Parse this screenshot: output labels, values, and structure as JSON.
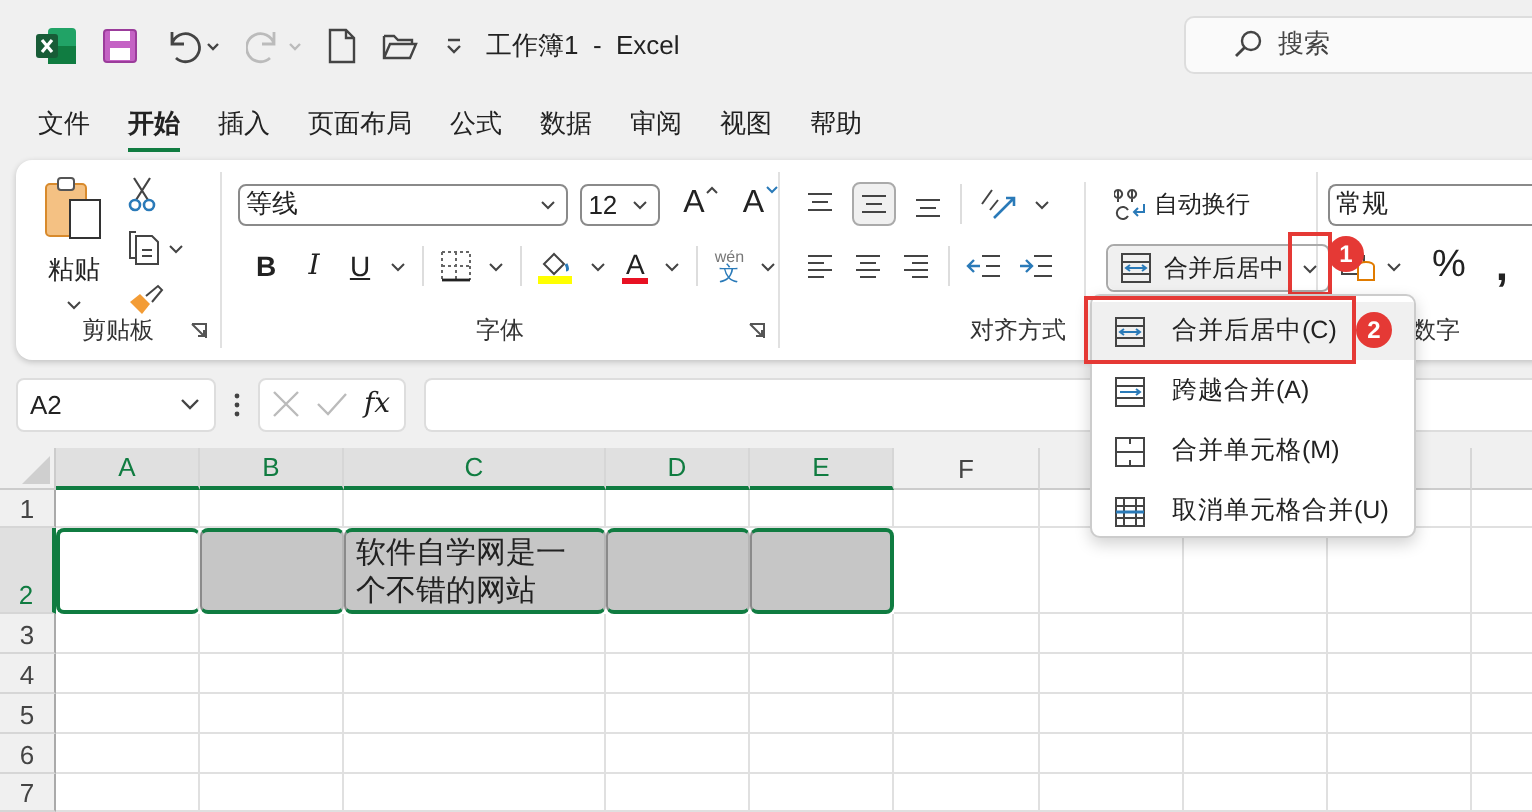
{
  "title_bar": {
    "title": "工作簿1  -  Excel",
    "search": {
      "placeholder": "搜索"
    }
  },
  "tabs": [
    {
      "label": "文件",
      "selected": false
    },
    {
      "label": "开始",
      "selected": true
    },
    {
      "label": "插入",
      "selected": false
    },
    {
      "label": "页面布局",
      "selected": false
    },
    {
      "label": "公式",
      "selected": false
    },
    {
      "label": "数据",
      "selected": false
    },
    {
      "label": "审阅",
      "selected": false
    },
    {
      "label": "视图",
      "selected": false
    },
    {
      "label": "帮助",
      "selected": false
    }
  ],
  "ribbon": {
    "clipboard": {
      "paste": "粘贴",
      "group_label": "剪贴板"
    },
    "font": {
      "font_name": "等线",
      "font_size": "12",
      "grow": "A",
      "shrink": "A",
      "bold": "B",
      "italic": "I",
      "underline": "U",
      "font_color": "A",
      "phonetic_top": "wén",
      "phonetic_bottom": "文",
      "group_label": "字体"
    },
    "alignment": {
      "wrap_text": "自动换行",
      "merge_button": "合并后居中",
      "merge_caret_highlighted": true,
      "group_label": "对齐方式"
    },
    "number": {
      "format": "常规",
      "percent": "%",
      "comma": ",",
      "group_label": "数字"
    }
  },
  "merge_menu": {
    "items": [
      {
        "kind": "center",
        "label": "合并后居中(C)",
        "selected": true,
        "highlighted": true
      },
      {
        "kind": "across",
        "label": "跨越合并(A)",
        "selected": false,
        "highlighted": false
      },
      {
        "kind": "cells",
        "label": "合并单元格(M)",
        "selected": false,
        "highlighted": false
      },
      {
        "kind": "unmerge",
        "label": "取消单元格合并(U)",
        "selected": false,
        "highlighted": false
      }
    ]
  },
  "step_badges": [
    "1",
    "2"
  ],
  "formula_bar": {
    "name_box": "A2",
    "fx": "fx"
  },
  "sheet": {
    "columns": [
      {
        "label": "A",
        "selected": true
      },
      {
        "label": "B",
        "selected": true
      },
      {
        "label": "C",
        "selected": true
      },
      {
        "label": "D",
        "selected": true
      },
      {
        "label": "E",
        "selected": true
      },
      {
        "label": "F",
        "selected": false
      }
    ],
    "rows": [
      {
        "label": "1",
        "selected": false
      },
      {
        "label": "2",
        "selected": true,
        "cells": [
          {
            "active": true
          },
          {
            "active": false
          },
          {
            "active": false,
            "text": "软件自学网是一个不错的网站"
          },
          {
            "active": false
          },
          {
            "active": false
          }
        ]
      },
      {
        "label": "3",
        "selected": false
      },
      {
        "label": "4",
        "selected": false
      },
      {
        "label": "5",
        "selected": false
      },
      {
        "label": "6",
        "selected": false
      },
      {
        "label": "7",
        "selected": false
      }
    ]
  }
}
